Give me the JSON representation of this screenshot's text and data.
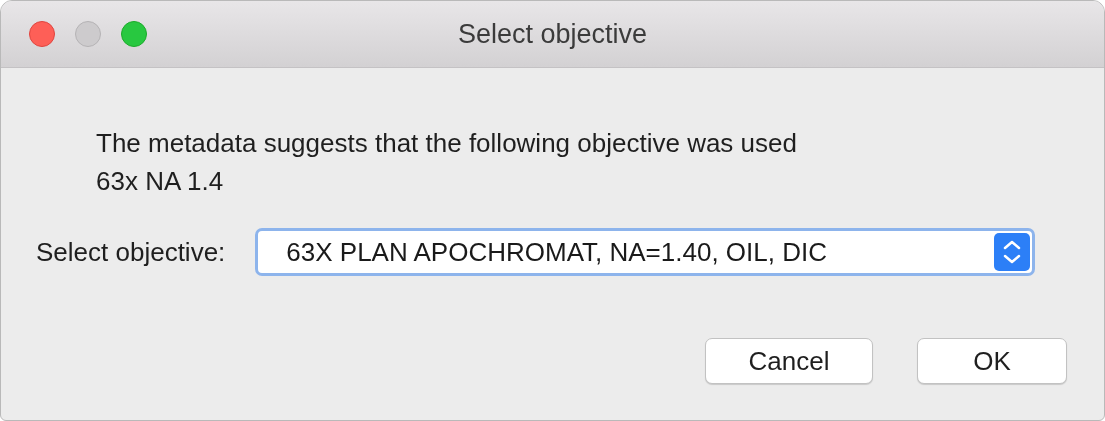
{
  "window": {
    "title": "Select objective",
    "controls": [
      {
        "kind": "close",
        "disabled": false
      },
      {
        "kind": "minimize",
        "disabled": true
      },
      {
        "kind": "zoom",
        "disabled": false
      }
    ]
  },
  "message": [
    "The metadata suggests that the following objective was used",
    "63x NA 1.4"
  ],
  "select": {
    "label": "Select objective:",
    "value": "63X PLAN APOCHROMAT, NA=1.40, OIL, DIC"
  },
  "buttons": [
    "Cancel",
    "OK"
  ]
}
